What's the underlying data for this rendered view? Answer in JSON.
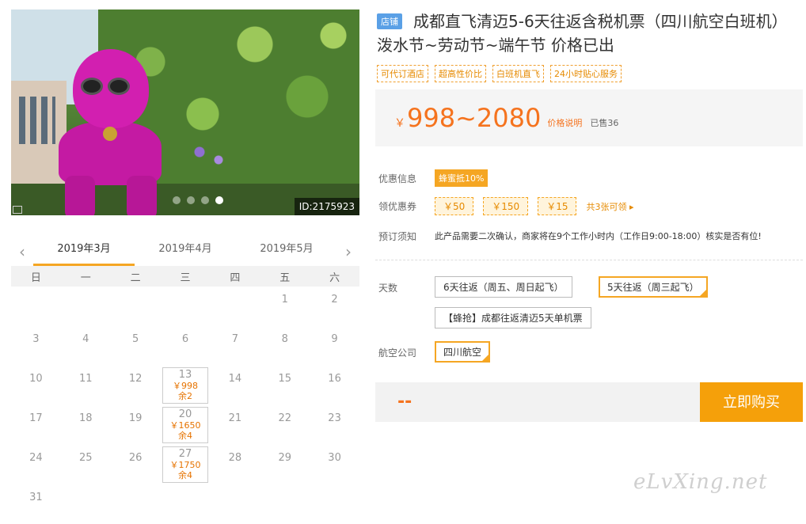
{
  "photo": {
    "id_label": "ID:2175923",
    "slide_count": 4,
    "active_slide": 3
  },
  "calendar": {
    "months": [
      "2019年3月",
      "2019年4月",
      "2019年5月"
    ],
    "active_month": 0,
    "weekdays": [
      "日",
      "一",
      "二",
      "三",
      "四",
      "五",
      "六"
    ],
    "cells": [
      {
        "day": ""
      },
      {
        "day": ""
      },
      {
        "day": ""
      },
      {
        "day": ""
      },
      {
        "day": ""
      },
      {
        "day": "1"
      },
      {
        "day": "2"
      },
      {
        "day": "3"
      },
      {
        "day": "4"
      },
      {
        "day": "5"
      },
      {
        "day": "6"
      },
      {
        "day": "7"
      },
      {
        "day": "8"
      },
      {
        "day": "9"
      },
      {
        "day": "10"
      },
      {
        "day": "11"
      },
      {
        "day": "12"
      },
      {
        "day": "13",
        "price": "￥998",
        "stock": "余2"
      },
      {
        "day": "14"
      },
      {
        "day": "15"
      },
      {
        "day": "16"
      },
      {
        "day": "17"
      },
      {
        "day": "18"
      },
      {
        "day": "19"
      },
      {
        "day": "20",
        "price": "￥1650",
        "stock": "余4"
      },
      {
        "day": "21"
      },
      {
        "day": "22"
      },
      {
        "day": "23"
      },
      {
        "day": "24"
      },
      {
        "day": "25"
      },
      {
        "day": "26"
      },
      {
        "day": "27",
        "price": "￥1750",
        "stock": "余4"
      },
      {
        "day": "28"
      },
      {
        "day": "29"
      },
      {
        "day": "30"
      },
      {
        "day": "31"
      }
    ]
  },
  "product": {
    "store_tag": "店铺",
    "title": "成都直飞清迈5-6天往返含税机票（四川航空白班机）泼水节~劳动节~端午节 价格已出",
    "features": [
      "可代订酒店",
      "超高性价比",
      "白班机直飞",
      "24小时贴心服务"
    ]
  },
  "price": {
    "currency": "￥",
    "range": "998~2080",
    "explain_label": "价格说明",
    "sold_label": "已售36"
  },
  "promo": {
    "discount_label": "优惠信息",
    "discount_badge": "蜂蜜抵10%",
    "coupon_label": "领优惠券",
    "coupons": [
      "￥50",
      "￥150",
      "￥15"
    ],
    "coupon_more": "共3张可领 ▸",
    "notice_label": "预订须知",
    "notice_text": "此产品需要二次确认，商家将在9个工作小时内（工作日9:00-18:00）核实是否有位!"
  },
  "options": {
    "days_label": "天数",
    "days": [
      "6天往返（周五、周日起飞）",
      "5天往返（周三起飞）",
      "【蜂抢】成都往返清迈5天单机票"
    ],
    "selected_day": 1,
    "airline_label": "航空公司",
    "airlines": [
      "四川航空"
    ],
    "selected_airline": 0
  },
  "buy": {
    "total_placeholder": "--",
    "button_label": "立即购买"
  },
  "watermark": "eLvXing.net"
}
